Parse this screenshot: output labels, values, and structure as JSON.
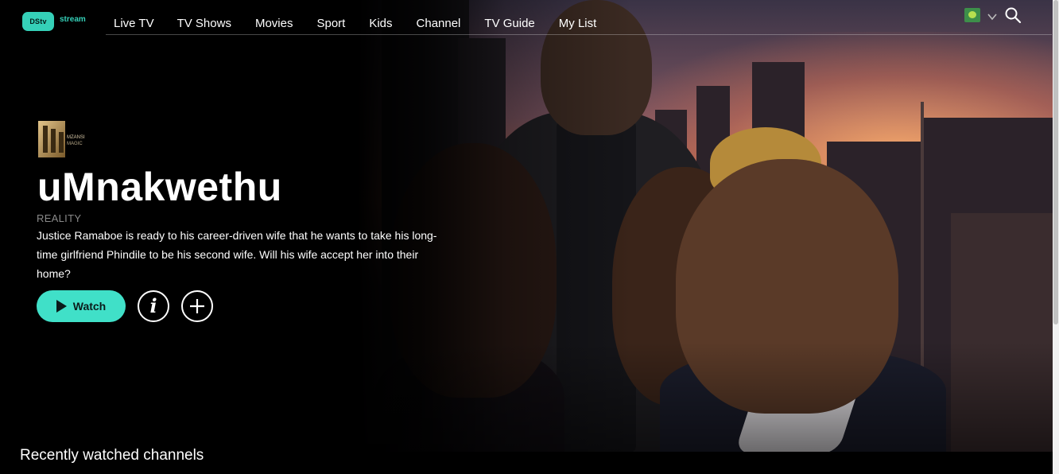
{
  "app": {
    "brand_badge": "DStv",
    "brand_text": "stream"
  },
  "nav": {
    "items": [
      "Live TV",
      "TV Shows",
      "Movies",
      "Sport",
      "Kids",
      "Channel",
      "TV Guide",
      "My List"
    ]
  },
  "hero": {
    "channel_logo_text": "MZANSI MAGIC",
    "title": "uMnakwethu",
    "genre": "REALITY",
    "synopsis": "Justice Ramaboe is ready to his career-driven wife that he wants to take his long-time girlfriend Phindile to be his second wife. Will his wife accept her into their home?",
    "watch_label": "Watch",
    "info_icon": "info-icon",
    "add_icon": "plus-icon"
  },
  "sections": {
    "recent_channels_title": "Recently watched channels"
  },
  "colors": {
    "accent": "#40e0c8",
    "background": "#000000"
  }
}
